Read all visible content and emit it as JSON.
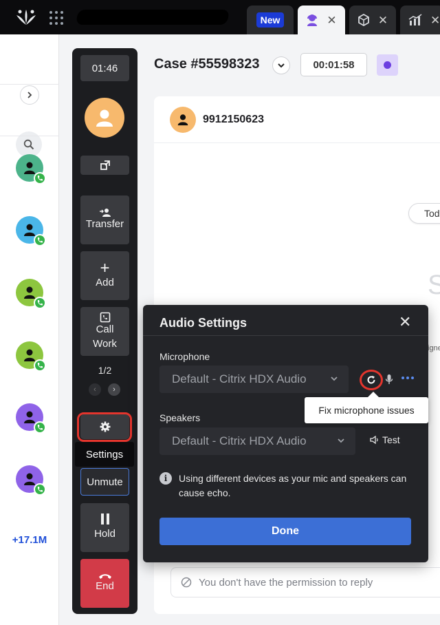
{
  "topbar": {
    "tabs": [
      {
        "label": "New",
        "close": "✕"
      },
      {
        "icon": "agent-icon",
        "close": "✕"
      },
      {
        "icon": "box-icon",
        "close": "✕"
      },
      {
        "icon": "chart-icon",
        "close": "✕"
      }
    ]
  },
  "sidebar": {
    "collapse_icon": "chevron-right-icon",
    "more_count": "+17.1M",
    "contacts": [
      {
        "color": "#4cb38a"
      },
      {
        "color": "#4ab6e8"
      },
      {
        "color": "#8dc63f"
      },
      {
        "color": "#8dc63f"
      },
      {
        "color": "#8f63e8"
      },
      {
        "color": "#8f63e8"
      }
    ]
  },
  "call_panel": {
    "timer": "01:46",
    "transfer_label": "Transfer",
    "add_label": "Add",
    "call_work_label": "Call Work",
    "page_indicator": "1/2",
    "settings_tooltip": "Settings",
    "unmute_label": "Unmute",
    "hold_label": "Hold",
    "end_label": "End"
  },
  "case": {
    "title": "Case #55598323",
    "timer": "00:01:58",
    "status_color": "#6c3fe0"
  },
  "conversation": {
    "phone": "9912150623",
    "today_label": "Tod",
    "ghost_letter": "S",
    "edge_text": "igne",
    "reply_placeholder": "You don't have the permission to reply"
  },
  "audio_dialog": {
    "title": "Audio Settings",
    "microphone_label": "Microphone",
    "microphone_value": "Default - Citrix HDX Audio",
    "fix_tooltip": "Fix microphone issues",
    "speakers_label": "Speakers",
    "speakers_value": "Default - Citrix HDX Audio",
    "test_label": "Test",
    "info_text": "Using different devices as your mic and speakers can cause echo.",
    "done_label": "Done"
  },
  "colors": {
    "accent": "#3c6fd6",
    "end_red": "#d23b48",
    "highlight_red": "#e4352d"
  }
}
